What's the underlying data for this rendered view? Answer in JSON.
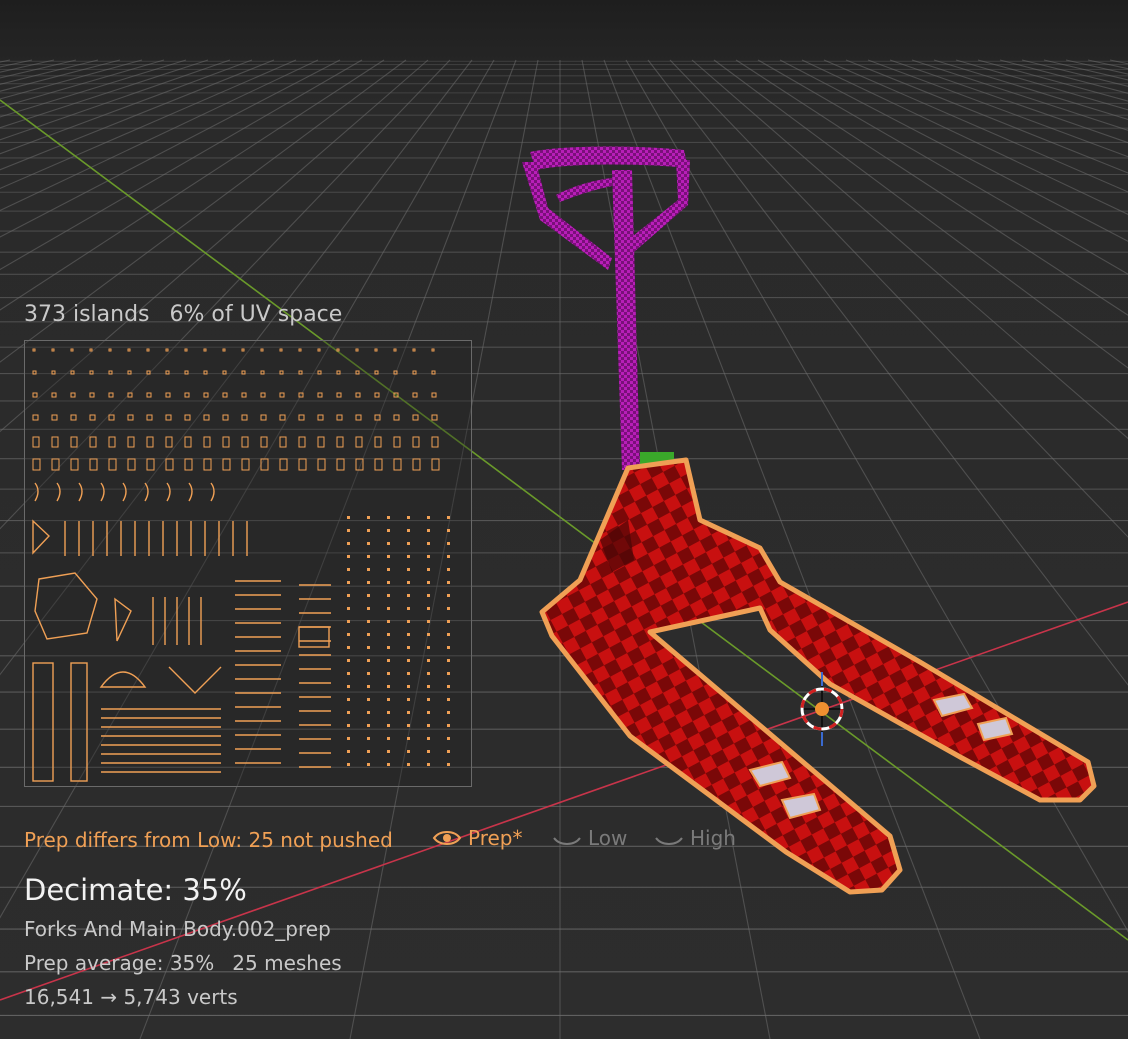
{
  "uv": {
    "islands": "373 islands",
    "coverage": "6% of UV space"
  },
  "status": {
    "warning": "Prep differs from Low: 25 not pushed",
    "views": [
      {
        "label": "Prep*",
        "active": true
      },
      {
        "label": "Low",
        "active": false
      },
      {
        "label": "High",
        "active": false
      }
    ]
  },
  "decimate": {
    "title": "Decimate: 35%",
    "mesh_name": "Forks And Main Body.002_prep",
    "prep_average": "Prep average: 35%",
    "mesh_count": "25 meshes",
    "verts": "16,541 → 5,743 verts"
  },
  "colors": {
    "selection_orange": "#f0a055",
    "handle_magenta": "#b81eb8",
    "body_red": "#c81010",
    "axis_x_red": "#c8344a",
    "axis_y_green": "#6a9a2a",
    "grid": "#6e6e6e"
  }
}
